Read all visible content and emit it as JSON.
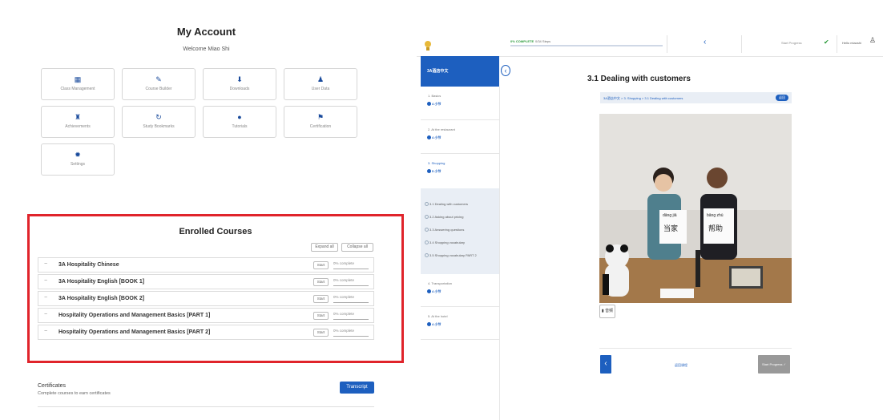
{
  "account": {
    "title": "My Account",
    "welcome": "Welcome Miao Shi",
    "tiles": [
      {
        "label": "Class Management",
        "icon": "table-icon",
        "glyph": "▦"
      },
      {
        "label": "Course Builder",
        "icon": "pencil-icon",
        "glyph": "✎"
      },
      {
        "label": "Downloads",
        "icon": "download-icon",
        "glyph": "⬇"
      },
      {
        "label": "User Data",
        "icon": "user-data-icon",
        "glyph": "♟"
      },
      {
        "label": "Achievements",
        "icon": "trophy-icon",
        "glyph": "♜"
      },
      {
        "label": "Study Bookmarks",
        "icon": "history-icon",
        "glyph": "↻"
      },
      {
        "label": "Tutorials",
        "icon": "play-icon",
        "glyph": "●"
      },
      {
        "label": "Certification",
        "icon": "flag-icon",
        "glyph": "⚑"
      },
      {
        "label": "Settings",
        "icon": "gear-icon",
        "glyph": "✹"
      }
    ]
  },
  "enrolled": {
    "title": "Enrolled Courses",
    "expand_label": "Expand all",
    "collapse_label": "Collapse all",
    "courses": [
      {
        "name": "3A Hospitality Chinese",
        "start": "Start",
        "progress": "0% complete"
      },
      {
        "name": "3A Hospitality English [BOOK 1]",
        "start": "Start",
        "progress": "0% complete"
      },
      {
        "name": "3A Hospitality English [BOOK 2]",
        "start": "Start",
        "progress": "0% complete"
      },
      {
        "name": "Hospitality Operations and Management Basics [PART 1]",
        "start": "Start",
        "progress": "0% complete"
      },
      {
        "name": "Hospitality Operations and Management Basics [PART 2]",
        "start": "Start",
        "progress": "0% complete"
      }
    ]
  },
  "certificates": {
    "title": "Certificates",
    "subtitle": "Complete courses to earn certificates",
    "transcript_label": "Transcript"
  },
  "player": {
    "progress_label": "0% COMPLETE",
    "steps_label": "0/34 Steps",
    "progress_fraction": 0,
    "start_progress_label": "Start Progress",
    "hello_label": "Hello miaoshi",
    "course_title": "3A酒店中文",
    "sections": [
      {
        "title": "1. Basics",
        "badge": "4 小节"
      },
      {
        "title": "2. At the restaurant",
        "badge": "4 小节"
      },
      {
        "title": "3. Shopping",
        "badge": "5 小节"
      },
      {
        "title": "4. Transportation",
        "badge": "4 小节"
      },
      {
        "title": "5. At the hotel",
        "badge": "4 小节"
      }
    ],
    "lessons": [
      "3.1 Dealing with customers",
      "3.2 Asking about pricing",
      "3.3 Answering questions",
      "3.4 Shopping vocabulary",
      "3.5 Shopping vocabulary PART 2"
    ],
    "lesson_title": "3.1 Dealing with customers",
    "breadcrumb": "3A酒店中文 > 3. Shopping > 3.1 Dealing with customers",
    "breadcrumb_button": "返回",
    "video_cards": [
      "dāng jiā",
      "当家",
      "bāng zhù",
      "帮助"
    ],
    "audio_label": "音频",
    "bottom_mid": "返回课程",
    "bottom_start": "Start Progress"
  },
  "colors": {
    "accent": "#1d5fbf",
    "highlight": "#e0242b",
    "success": "#2a9a3a"
  }
}
